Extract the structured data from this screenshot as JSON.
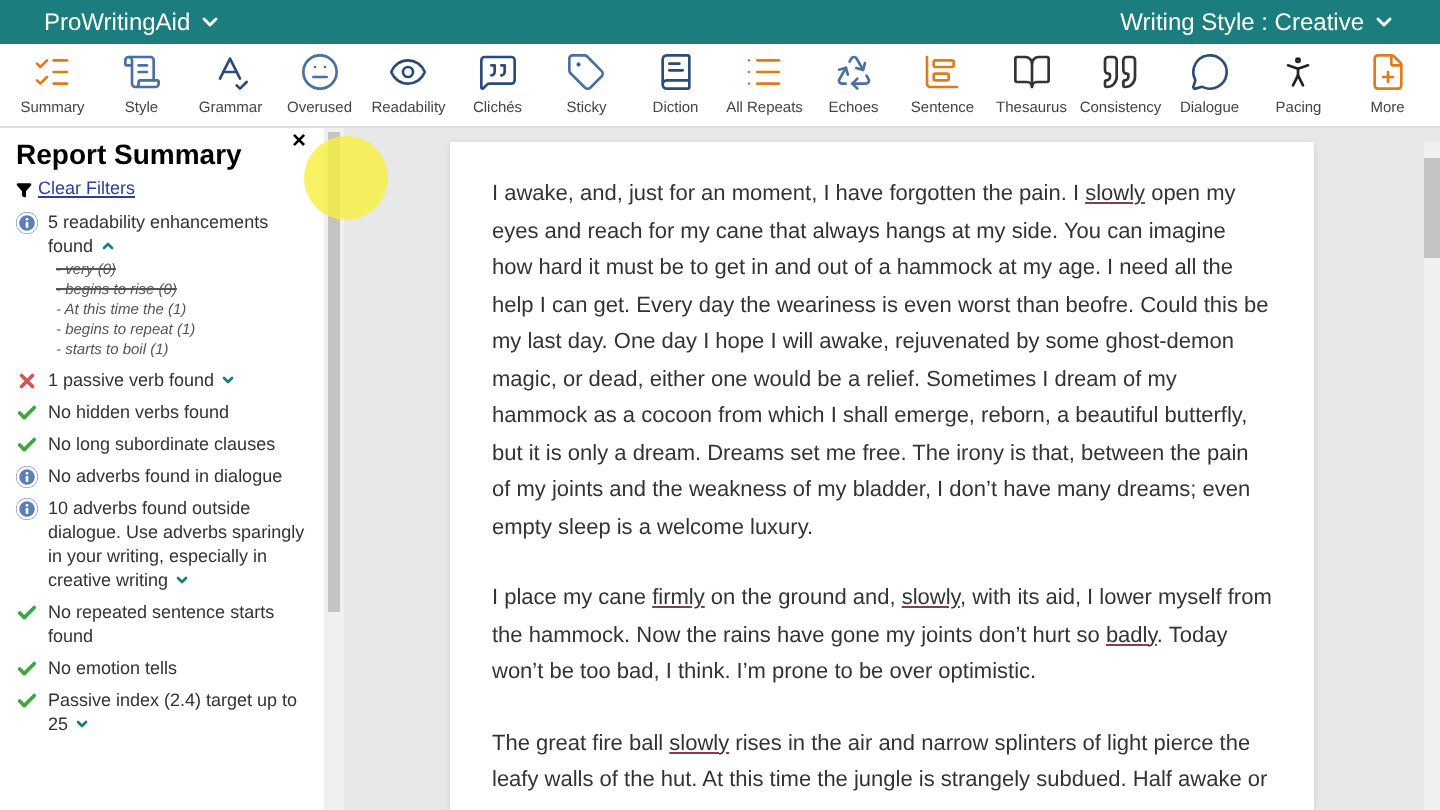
{
  "app_bar": {
    "brand": "ProWritingAid",
    "writing_style": "Writing Style : Creative"
  },
  "toolbar": [
    {
      "label": "Summary"
    },
    {
      "label": "Style"
    },
    {
      "label": "Grammar"
    },
    {
      "label": "Overused"
    },
    {
      "label": "Readability"
    },
    {
      "label": "Clichés"
    },
    {
      "label": "Sticky"
    },
    {
      "label": "Diction"
    },
    {
      "label": "All Repeats"
    },
    {
      "label": "Echoes"
    },
    {
      "label": "Sentence"
    },
    {
      "label": "Thesaurus"
    },
    {
      "label": "Consistency"
    },
    {
      "label": "Dialogue"
    },
    {
      "label": "Pacing"
    },
    {
      "label": "More"
    }
  ],
  "report": {
    "title": "Report Summary",
    "close": "×",
    "filter_link": "Clear Filters",
    "items": [
      {
        "kind": "info",
        "text": "5 readability enhancements found",
        "expanded": true,
        "children": [
          {
            "text": "- very (0)",
            "struck": true
          },
          {
            "text": "- begins to rise (0)",
            "struck": true
          },
          {
            "text": "- At this time the (1)",
            "struck": false
          },
          {
            "text": "- begins to repeat (1)",
            "struck": false
          },
          {
            "text": "- starts to boil (1)",
            "struck": false
          }
        ]
      },
      {
        "kind": "error",
        "text": "1 passive verb found",
        "expanded": false
      },
      {
        "kind": "ok",
        "text": "No hidden verbs found"
      },
      {
        "kind": "ok",
        "text": "No long subordinate clauses"
      },
      {
        "kind": "info",
        "text": "No adverbs found in dialogue"
      },
      {
        "kind": "info",
        "text": "10 adverbs found outside dialogue. Use adverbs sparingly in your writing, especially in creative writing",
        "expanded": false
      },
      {
        "kind": "ok",
        "text": "No repeated sentence starts found"
      },
      {
        "kind": "ok",
        "text": "No emotion tells"
      },
      {
        "kind": "ok",
        "text": "Passive index (2.4) target up to 25",
        "expanded": false
      }
    ]
  },
  "document": {
    "paragraphs": [
      [
        {
          "text": "I awake, and, just for an moment, I have forgotten the pain. I ",
          "underlined": false
        },
        {
          "text": "slowly",
          "underlined": true
        },
        {
          "text": " open my eyes and reach for my cane that always hangs at my side. You can imagine how hard it must be to get in and out of a hammock at my age. I need all the help I can get. Every day the weariness is even worst than beofre. Could this be my last day. One day I hope I will awake, rejuvenated by some ghost-demon magic, or dead, either one would be a relief. Sometimes I dream of my hammock as a cocoon from which I shall emerge, reborn, a beautiful butterfly, but it is only a dream. Dreams set me free. The irony is that, between the pain of my joints and the weakness of my bladder, I don’t have many dreams; even empty sleep is a welcome luxury.",
          "underlined": false
        }
      ],
      [
        {
          "text": "I place my cane ",
          "underlined": false
        },
        {
          "text": "firmly",
          "underlined": true
        },
        {
          "text": " on the ground and, ",
          "underlined": false
        },
        {
          "text": "slowly",
          "underlined": true
        },
        {
          "text": ", with its aid, I lower myself from the hammock. Now the rains have gone my joints don’t hurt so ",
          "underlined": false
        },
        {
          "text": "badly",
          "underlined": true
        },
        {
          "text": ". Today won’t be too bad, I think. I’m prone to be over optimistic.",
          "underlined": false
        }
      ],
      [
        {
          "text": "The great fire ball ",
          "underlined": false
        },
        {
          "text": "slowly",
          "underlined": true
        },
        {
          "text": " rises in the air and narrow splinters of light pierce the leafy walls of the hut. At this time the jungle is strangely subdued. Half awake or",
          "underlined": false
        }
      ]
    ]
  }
}
